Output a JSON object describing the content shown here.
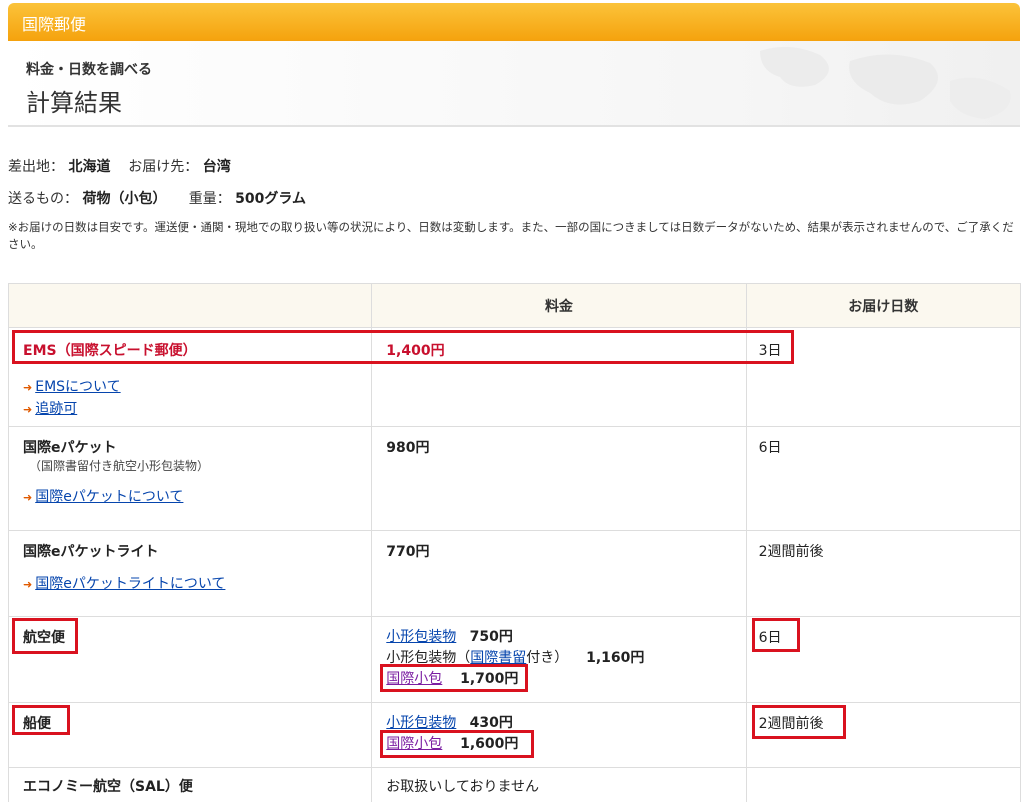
{
  "header": {
    "bar_title": "国際郵便",
    "subtitle": "料金・日数を調べる",
    "title": "計算結果"
  },
  "info": {
    "origin_label": "差出地：",
    "origin_value": "北海道",
    "dest_label": "お届け先：",
    "dest_value": "台湾",
    "item_label": "送るもの：",
    "item_value": "荷物（小包）",
    "weight_label": "重量：",
    "weight_value": "500グラム",
    "note": "※お届けの日数は目安です。運送便・通関・現地での取り扱い等の状況により、日数は変動します。また、一部の国につきましては日数データがないため、結果が表示されませんので、ご了承ください。"
  },
  "table": {
    "headers": [
      "",
      "料金",
      "お届け日数"
    ],
    "rows": {
      "ems": {
        "name": "EMS（国際スピード郵便）",
        "price": "1,400円",
        "days": "3日",
        "links": [
          "EMSについて",
          "追跡可"
        ]
      },
      "epacket": {
        "name": "国際eパケット",
        "subnote": "（国際書留付き航空小形包装物）",
        "price": "980円",
        "days": "6日",
        "link": "国際eパケットについて"
      },
      "epacket_lite": {
        "name": "国際eパケットライト",
        "price": "770円",
        "days": "2週間前後",
        "link": "国際eパケットライトについて"
      },
      "air": {
        "name": "航空便",
        "line1_link": "小形包装物",
        "line1_price": "750円",
        "line2_prefix": "小形包装物（",
        "line2_link": "国際書留",
        "line2_suffix": "付き）",
        "line2_price": "1,160円",
        "line3_link": "国際小包",
        "line3_price": "1,700円",
        "days": "6日"
      },
      "ship": {
        "name": "船便",
        "line1_link": "小形包装物",
        "line1_price": "430円",
        "line2_link": "国際小包",
        "line2_price": "1,600円",
        "days": "2週間前後"
      },
      "sal": {
        "name": "エコノミー航空（SAL）便",
        "price": "お取扱いしておりません"
      }
    }
  },
  "colors": {
    "accent_orange": "#f5a20d",
    "ems_red": "#c8102e",
    "highlight_box": "#d9121f",
    "link_blue": "#0645ad",
    "link_visited": "#7b1fa2"
  }
}
